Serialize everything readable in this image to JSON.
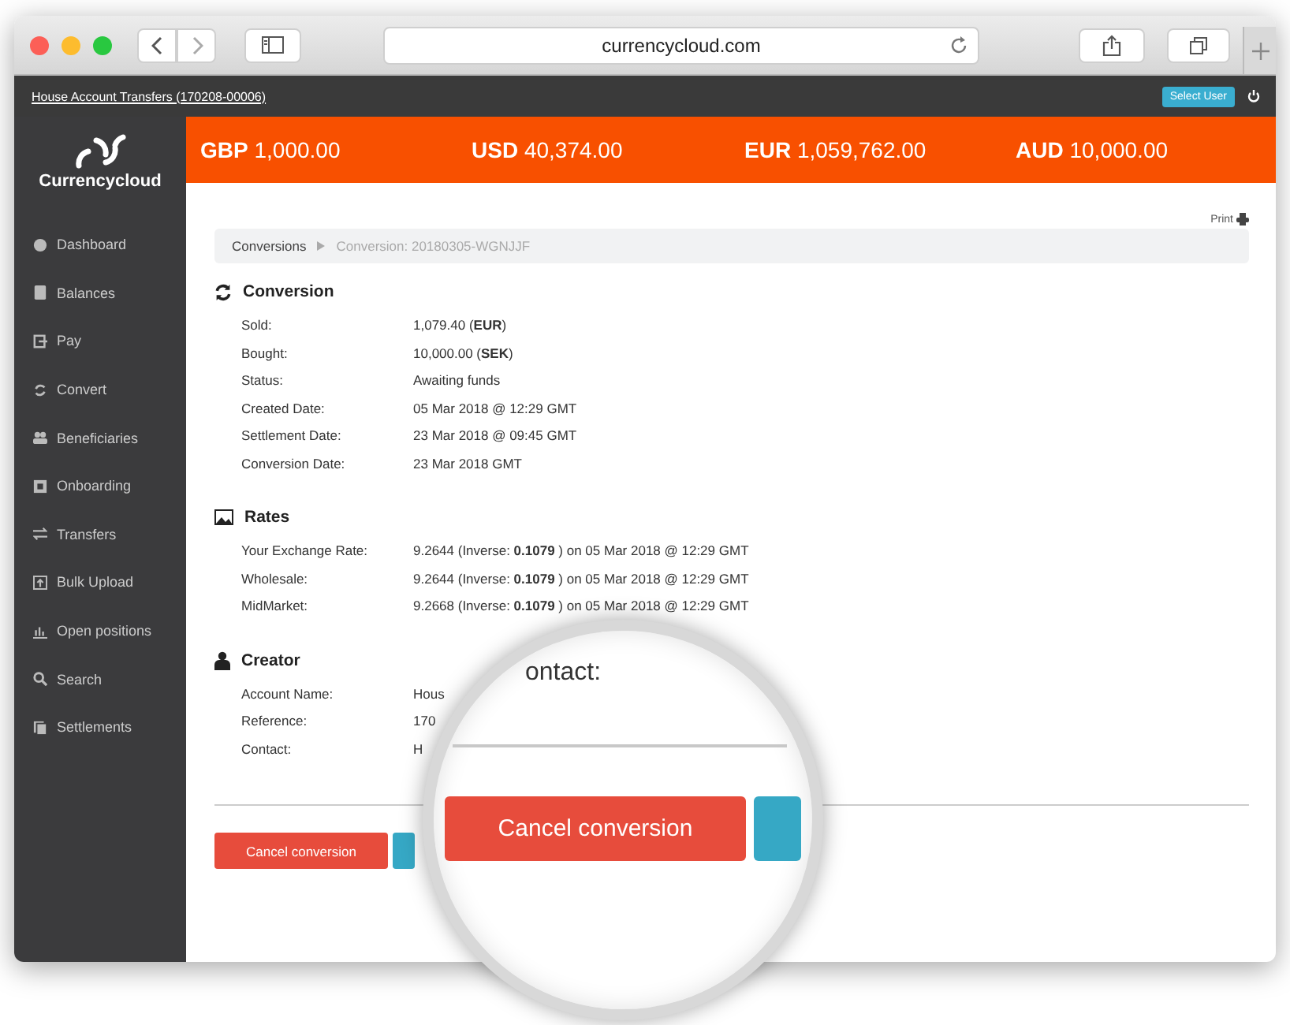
{
  "browser": {
    "url": "currencycloud.com"
  },
  "top_bar": {
    "account_link": "House Account Transfers (170208-00006)",
    "select_user_button": "Select User"
  },
  "logo": {
    "name": "Currencycloud"
  },
  "sidebar": {
    "items": [
      {
        "label": "Dashboard"
      },
      {
        "label": "Balances"
      },
      {
        "label": "Pay"
      },
      {
        "label": "Convert"
      },
      {
        "label": "Beneficiaries"
      },
      {
        "label": "Onboarding"
      },
      {
        "label": "Transfers"
      },
      {
        "label": "Bulk Upload"
      },
      {
        "label": "Open positions"
      },
      {
        "label": "Search"
      },
      {
        "label": "Settlements"
      }
    ]
  },
  "balances": [
    {
      "code": "GBP",
      "amount": "1,000.00"
    },
    {
      "code": "USD",
      "amount": "40,374.00"
    },
    {
      "code": "EUR",
      "amount": "1,059,762.00"
    },
    {
      "code": "AUD",
      "amount": "10,000.00"
    }
  ],
  "print_link": "Print",
  "breadcrumb": [
    {
      "label": "Conversions",
      "current": false
    },
    {
      "label": "Conversion: 20180305-WGNJJF",
      "current": true
    }
  ],
  "sections": [
    {
      "kind": "conversion",
      "title": "Conversion",
      "rows": [
        {
          "label": "Sold:",
          "value": "1,079.40 (**EUR**)"
        },
        {
          "label": "Bought:",
          "value": "10,000.00 (**SEK**)"
        },
        {
          "label": "Status:",
          "value": "Awaiting funds"
        },
        {
          "label": "Created Date:",
          "value": "05 Mar 2018 @ 12:29 GMT"
        },
        {
          "label": "Settlement Date:",
          "value": "23 Mar 2018 @ 09:45 GMT"
        },
        {
          "label": "Conversion Date:",
          "value": "23 Mar 2018 GMT"
        }
      ]
    },
    {
      "kind": "rates",
      "title": "Rates",
      "rows": [
        {
          "label": "Your Exchange Rate:",
          "value": "9.2644 (Inverse: **0.1079** ) on 05 Mar 2018 @ 12:29 GMT"
        },
        {
          "label": "Wholesale:",
          "value": "9.2644 (Inverse: **0.1079** ) on 05 Mar 2018 @ 12:29 GMT"
        },
        {
          "label": "MidMarket:",
          "value": "9.2668 (Inverse: **0.1079** ) on 05 Mar 2018 @ 12:29 GMT"
        }
      ]
    },
    {
      "kind": "creator",
      "title": "Creator",
      "rows": [
        {
          "label": "Account Name:",
          "value": "Hous"
        },
        {
          "label": "Reference:",
          "value": "170"
        },
        {
          "label": "Contact:",
          "value": "H"
        }
      ]
    }
  ],
  "cancel_button": "Cancel conversion",
  "magnifier": {
    "label": "ontact:",
    "button": "Cancel conversion"
  }
}
